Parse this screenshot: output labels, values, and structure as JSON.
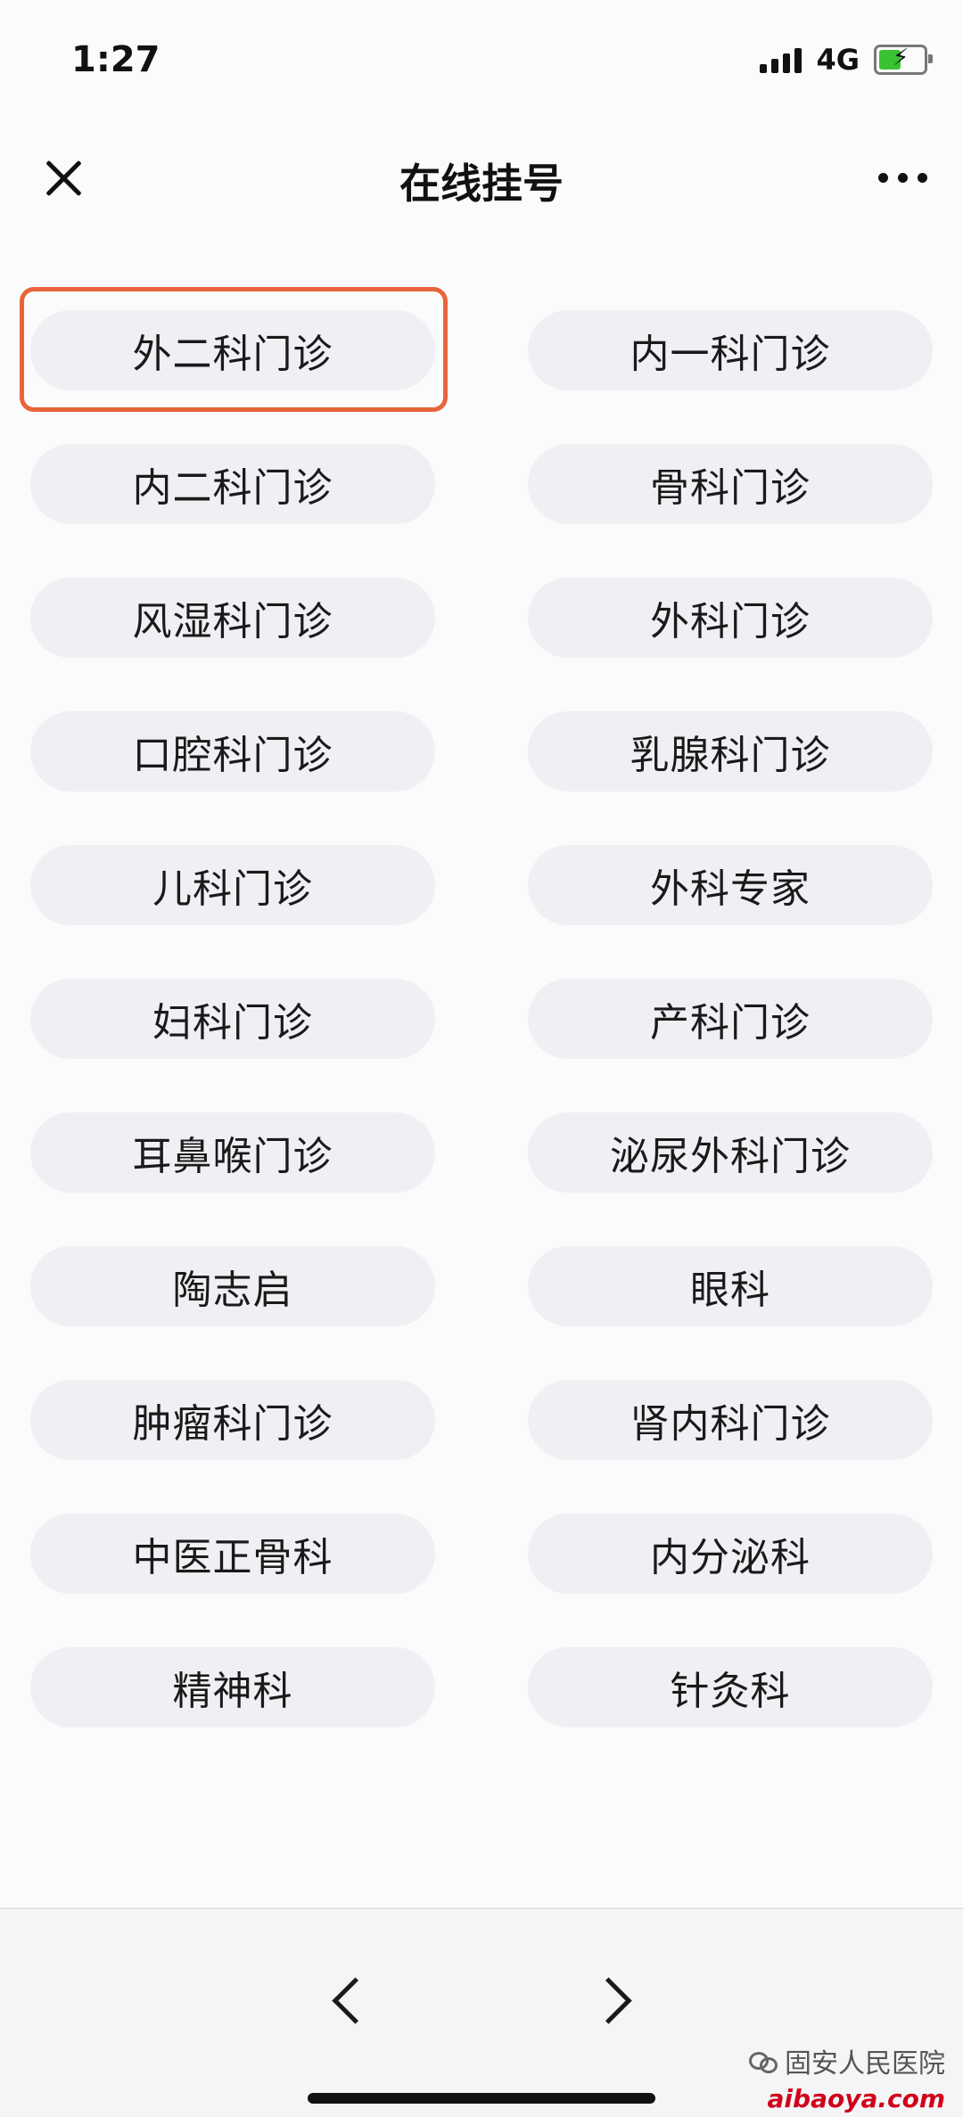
{
  "status_bar": {
    "time": "1:27",
    "network": "4G"
  },
  "nav": {
    "title": "在线挂号"
  },
  "departments": [
    "外二科门诊",
    "内一科门诊",
    "内二科门诊",
    "骨科门诊",
    "风湿科门诊",
    "外科门诊",
    "口腔科门诊",
    "乳腺科门诊",
    "儿科门诊",
    "外科专家",
    "妇科门诊",
    "产科门诊",
    "耳鼻喉门诊",
    "泌尿外科门诊",
    "陶志启",
    "眼科",
    "肿瘤科门诊",
    "肾内科门诊",
    "中医正骨科",
    "内分泌科",
    "精神科",
    "针灸科"
  ],
  "highlighted_department": "外二科门诊",
  "colors": {
    "highlight": "#e8643a",
    "button_bg": "#f0f0f4",
    "battery": "#39c234"
  },
  "watermark": {
    "account": "固安人民医院",
    "site": "aibaoya.com"
  }
}
